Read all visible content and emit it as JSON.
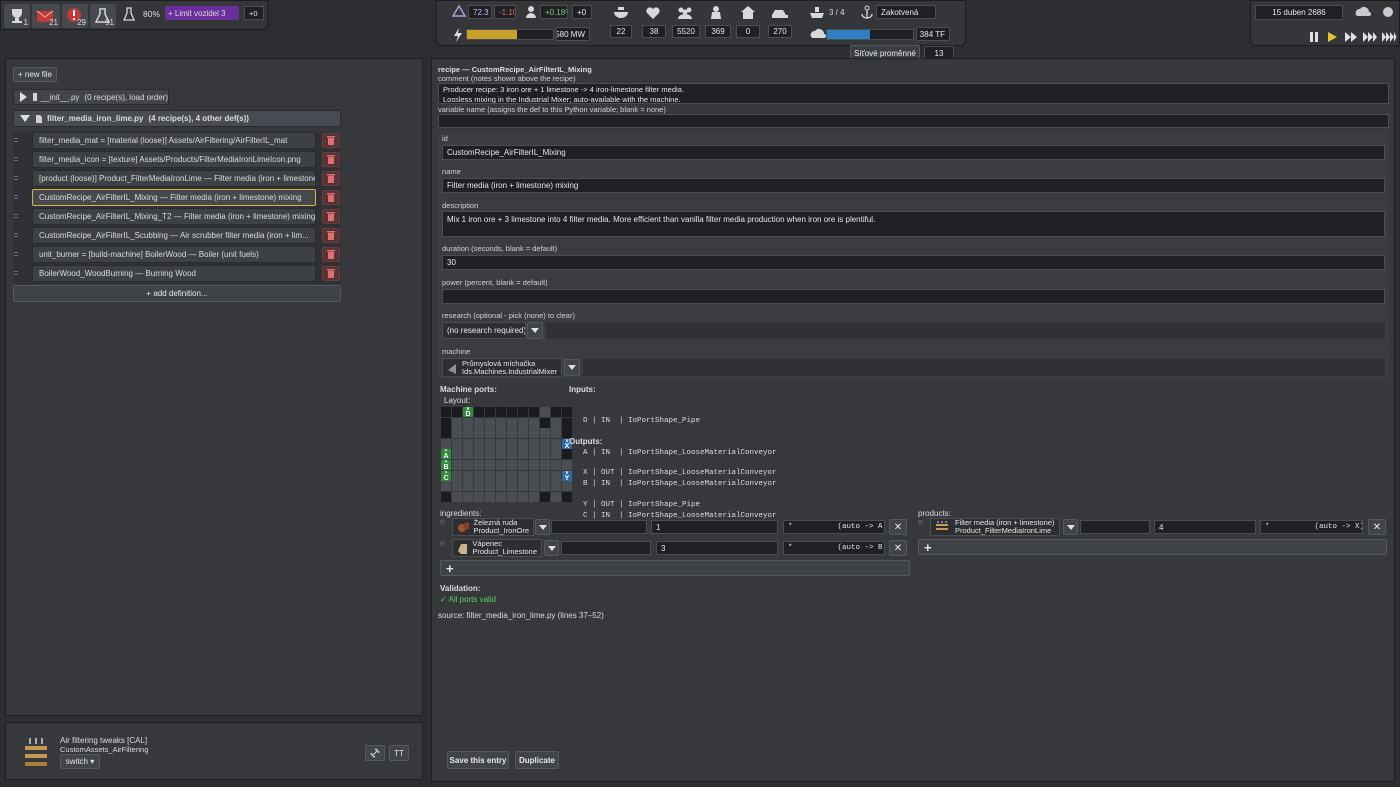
{
  "hud": {
    "badges": [
      {
        "icon": "trophy-icon",
        "count": "1"
      },
      {
        "icon": "mail-icon",
        "count": "21",
        "color": "#c0393b"
      },
      {
        "icon": "alert-icon",
        "count": "29",
        "color": "#c0393b"
      },
      {
        "icon": "flask-icon",
        "count": "91"
      }
    ],
    "research_pct": "80%",
    "vehicle_limit": "+ Limit vozidel 3",
    "vehicle_delta": "+0",
    "unity_value": "72.3",
    "unity_delta": "-1.10",
    "pop_growth": "+0.18%",
    "pop_delta": "+0",
    "power": "580 MW",
    "power_fill": 0.58,
    "stats": [
      {
        "icon": "food-icon",
        "value": "22"
      },
      {
        "icon": "health-icon",
        "value": "38"
      },
      {
        "icon": "people-icon",
        "value": "5520"
      },
      {
        "icon": "worker-icon",
        "value": "369"
      },
      {
        "icon": "house-icon",
        "value": "0"
      },
      {
        "icon": "vehicle-icon",
        "value": "270"
      }
    ],
    "ships": "3 / 4",
    "ship_state": "Zakotvená",
    "computing": "384 TF",
    "computing_fill": 0.5,
    "net_vars_label": "Síťové proměnné",
    "net_vars_count": "13",
    "date": "15 duben 2686"
  },
  "left": {
    "new_file": "+ new file",
    "init_file": "__init__.py",
    "init_meta": "(0 recipe(s), load order)",
    "active_file": "filter_media_iron_lime.py",
    "active_meta": "(4 recipe(s), 4 other def(s))",
    "defs": [
      "filter_media_mat = [material (loose)] Assets/AirFiltering/AirFilterIL_mat",
      "filter_media_icon = [texture] Assets/Products/FilterMediaIronLimeIcon.png",
      "[product (loose)] Product_FilterMediaIronLime  —  Filter media (iron + limestone)",
      "CustomRecipe_AirFilterIL_Mixing  —  Filter media (iron + limestone) mixing",
      "CustomRecipe_AirFilterIL_Mixing_T2  —  Filter media (iron + limestone) mixing",
      "CustomRecipe_AirFilterIL_Scubbing  —  Air scrubber filter media (iron + lim...",
      "unit_burner = [build-machine] BoilerWood  —  Boiler (unit fuels)",
      "BoilerWood_WoodBurning  —  Burning Wood"
    ],
    "add_def": "+ add definition...",
    "mod_name": "Air filtering tweaks [CAL]",
    "mod_id": "CustomAssets_AirFiltering",
    "switch": "switch ▾",
    "tt": "TT"
  },
  "editor": {
    "header": "recipe — CustomRecipe_AirFilterIL_Mixing",
    "comment_label": "comment (notes shown above the recipe)",
    "comment_l1": "Producer recipe: 3 iron ore + 1 limestone -> 4 iron-limestone filter media.",
    "comment_l2": "Lossless mixing in the Industrial Mixer; auto-available with the machine.",
    "varname_label": "variable name (assigns the def to this Python variable; blank = none)",
    "varname": "",
    "id_label": "id",
    "id": "CustomRecipe_AirFilterIL_Mixing",
    "name_label": "name",
    "name": "Filter media (iron + limestone) mixing",
    "desc_label": "description",
    "desc": "Mix 1 iron ore + 3 limestone into 4 filter media. More efficient than vanilla filter media production when iron ore is plentiful.",
    "duration_label": "duration (seconds, blank = default)",
    "duration": "30",
    "power_label": "power (percent, blank = default)",
    "power": "",
    "research_label": "research (optional - pick (none) to clear)",
    "research": "(no research required)",
    "machine_label": "machine",
    "machine_name": "Průmyslová míchačka",
    "machine_id": "Ids.Machines.IndustrialMixer",
    "ports_title": "Machine ports:",
    "layout_label": "Layout:",
    "inputs_title": "Inputs:",
    "inputs": [
      "D | IN  | IoPortShape_Pipe",
      "A | IN  | IoPortShape_LooseMaterialConveyor",
      "B | IN  | IoPortShape_LooseMaterialConveyor",
      "C | IN  | IoPortShape_LooseMaterialConveyor"
    ],
    "outputs_title": "Outputs:",
    "outputs": [
      "X | OUT | IoPortShape_LooseMaterialConveyor",
      "Y | OUT | IoPortShape_Pipe"
    ],
    "port_letters": {
      "D": "D",
      "A": "A",
      "B": "B",
      "C": "C",
      "X": "X",
      "Y": "Y"
    },
    "ingredients_label": "ingredients:",
    "products_label": "products:",
    "ingredients": [
      {
        "name": "Železná ruda",
        "id": "Product_IronOre",
        "qty": "1",
        "port": "*          (auto -> A)",
        "icon": "iron-ore-icon"
      },
      {
        "name": "Vápenec",
        "id": "Product_Limestone",
        "qty": "3",
        "port": "*          (auto -> B)",
        "icon": "limestone-icon"
      }
    ],
    "products": [
      {
        "name": "Filter media (iron + limestone)",
        "id": "Product_FilterMediaIronLime",
        "qty": "4",
        "port": "*          (auto -> X)",
        "icon": "filter-media-icon"
      }
    ],
    "validation_label": "Validation:",
    "validation": "✓ All ports valid",
    "source": "source: filter_media_iron_lime.py (lines 37–52)",
    "save": "Save this entry",
    "duplicate": "Duplicate"
  }
}
